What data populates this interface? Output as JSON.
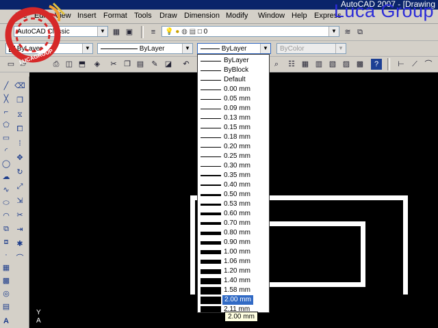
{
  "app": {
    "title": "AutoCAD 2007 - [Drawing",
    "brand": "Luca Group",
    "logo_text": "LUCAGROUP"
  },
  "menu": [
    "File",
    "Edit",
    "View",
    "Insert",
    "Format",
    "Tools",
    "Draw",
    "Dimension",
    "Modify",
    "Window",
    "Help",
    "Express"
  ],
  "workspace": {
    "value": "AutoCAD Classic"
  },
  "layer": {
    "value": "0"
  },
  "properties": {
    "color": "ByLayer",
    "linetype": "ByLayer",
    "lineweight": "ByLayer",
    "plotstyle": "ByColor"
  },
  "lineweight_options": [
    "ByLayer",
    "ByBlock",
    "Default",
    "0.00 mm",
    "0.05 mm",
    "0.09 mm",
    "0.13 mm",
    "0.15 mm",
    "0.18 mm",
    "0.20 mm",
    "0.25 mm",
    "0.30 mm",
    "0.35 mm",
    "0.40 mm",
    "0.50 mm",
    "0.53 mm",
    "0.60 mm",
    "0.70 mm",
    "0.80 mm",
    "0.90 mm",
    "1.00 mm",
    "1.06 mm",
    "1.20 mm",
    "1.40 mm",
    "1.58 mm",
    "2.00 mm",
    "2.11 mm"
  ],
  "selected_option": "2.00 mm",
  "tooltip": "2.00 mm",
  "ucs": {
    "y": "Y",
    "a": "A"
  },
  "colors": {
    "canvas": "#000000",
    "titlebar": "#0a246a",
    "brand": "#2b2bd8",
    "selection": "#316ac5",
    "logo": "#d62828"
  }
}
